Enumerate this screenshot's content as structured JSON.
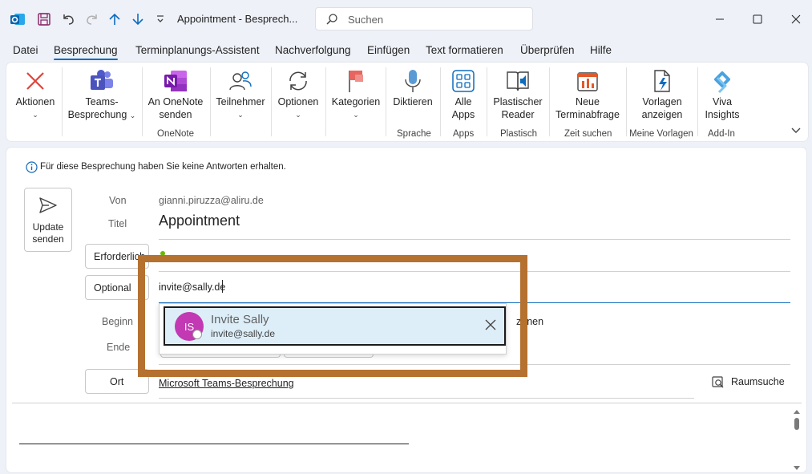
{
  "window": {
    "title": "Appointment  -  Besprech...",
    "search_placeholder": "Suchen"
  },
  "menu": [
    "Datei",
    "Besprechung",
    "Terminplanungs-Assistent",
    "Nachverfolgung",
    "Einfügen",
    "Text formatieren",
    "Überprüfen",
    "Hilfe"
  ],
  "ribbon": {
    "aktionen": "Aktionen",
    "teams_1": "Teams-",
    "teams_2": "Besprechung",
    "onenote_1": "An OneNote",
    "onenote_2": "senden",
    "teilnehmer": "Teilnehmer",
    "optionen": "Optionen",
    "kategorien": "Kategorien",
    "diktieren": "Diktieren",
    "apps_1": "Alle",
    "apps_2": "Apps",
    "reader_1": "Plastischer",
    "reader_2": "Reader",
    "umfrage_1": "Neue",
    "umfrage_2": "Terminabfrage",
    "vorlagen_1": "Vorlagen",
    "vorlagen_2": "anzeigen",
    "viva_1": "Viva",
    "viva_2": "Insights",
    "groups": {
      "onenote": "OneNote",
      "sprache": "Sprache",
      "apps": "Apps",
      "plastisch": "Plastisch",
      "zeit": "Zeit suchen",
      "vorlagen": "Meine Vorlagen",
      "addin": "Add-In"
    }
  },
  "info_bar": "Für diese Besprechung haben Sie keine Antworten erhalten.",
  "form": {
    "send_1": "Update",
    "send_2": "senden",
    "from_label": "Von",
    "from_value": "gianni.piruzza@aliru.de",
    "title_label": "Titel",
    "title_value": "Appointment",
    "required_btn": "Erforderlich",
    "optional_btn": "Optional",
    "optional_value": "invite@sally.de",
    "start_label": "Beginn",
    "end_label": "Ende",
    "timezone_fragment": "zonen",
    "location_btn": "Ort",
    "location_value": "Microsoft Teams-Besprechung",
    "room_search": "Raumsuche"
  },
  "suggestion": {
    "initials": "IS",
    "name": "Invite Sally",
    "email": "invite@sally.de"
  },
  "colors": {
    "accent": "#0f6cbd",
    "avatar": "#c239b3",
    "highlight": "#b5712f",
    "suggestion_bg": "#ddeef9"
  }
}
